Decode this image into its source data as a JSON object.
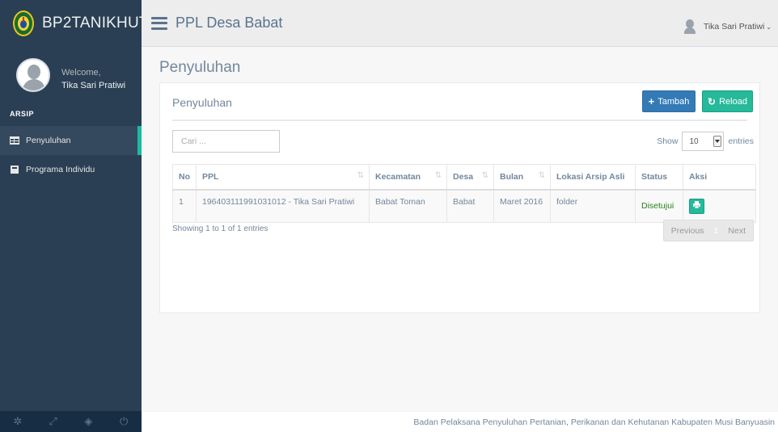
{
  "brand": {
    "title": "BP2TANIKHUT"
  },
  "profile": {
    "welcome": "Welcome,",
    "name": "Tika Sari Pratiwi"
  },
  "sidebar": {
    "section_label": "ARSIP",
    "items": [
      {
        "label": "Penyuluhan",
        "icon": "table-icon",
        "active": true
      },
      {
        "label": "Programa Individu",
        "icon": "square-icon",
        "active": false
      }
    ],
    "footer_icons": [
      "gear-icon",
      "fullscreen-icon",
      "eye-slash-icon",
      "power-icon"
    ]
  },
  "topnav": {
    "heading": "PPL Desa Babat",
    "user_name": "Tika Sari Pratiwi"
  },
  "main": {
    "page_title": "Penyuluhan",
    "panel_title": "Penyuluhan",
    "add_label": "Tambah",
    "reload_label": "Reload",
    "search_placeholder": "Cari ...",
    "show_label": "Show",
    "entries_value": "10",
    "entries_label": "entries",
    "table": {
      "headers": [
        "No",
        "PPL",
        "Kecamatan",
        "Desa",
        "Bulan",
        "Lokasi Arsip Asli",
        "Status",
        "Aksi"
      ],
      "rows": [
        {
          "no": "1",
          "ppl": "196403111991031012 - Tika Sari Pratiwi",
          "kecamatan": "Babat Toman",
          "desa": "Babat",
          "bulan": "Maret 2016",
          "lokasi": "folder",
          "status": "Disetujui",
          "aksi_icon": "print-icon"
        }
      ]
    },
    "info_text": "Showing 1 to 1 of 1 entries",
    "pagination": {
      "previous": "Previous",
      "current": "1",
      "next": "Next"
    }
  },
  "footer": {
    "text": "Badan Pelaksana Penyuluhan Pertanian, Perikanan dan Kehutanan Kabupaten Musi Banyuasin"
  },
  "colors": {
    "sidebar": "#2A3F54",
    "accent": "#1ABB9C",
    "primary": "#337AB7",
    "success": "#26B99A",
    "status_text": "#26801F"
  }
}
